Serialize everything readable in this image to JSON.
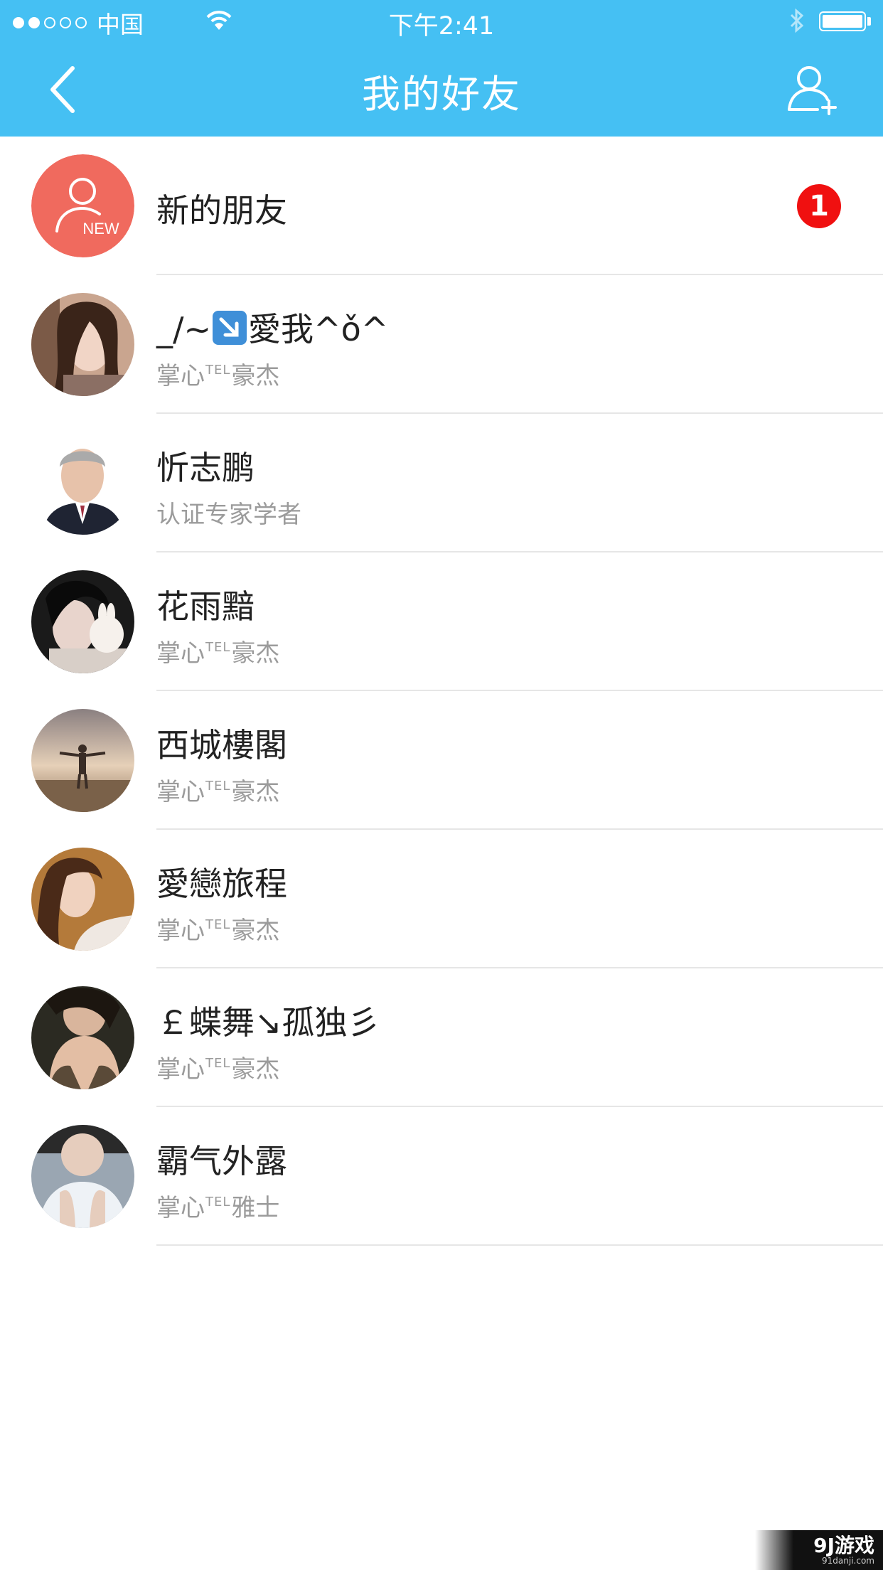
{
  "status_bar": {
    "carrier": "中国",
    "time": "下午2:41"
  },
  "nav": {
    "title": "我的好友",
    "back_icon": "chevron-left-icon",
    "add_icon": "add-user-icon"
  },
  "new_friends": {
    "label": "新的朋友",
    "avatar_text": "NEW",
    "badge_count": "1",
    "avatar_color": "#f06a5e"
  },
  "friends": [
    {
      "name_pre": "_/~",
      "name_post": "愛我^ǒ^",
      "sub_pre": "掌心",
      "sub_tel": "TEL",
      "sub_post": "豪杰"
    },
    {
      "name": "忻志鹏",
      "sub": "认证专家学者"
    },
    {
      "name": "花雨黯",
      "sub_pre": "掌心",
      "sub_tel": "TEL",
      "sub_post": "豪杰"
    },
    {
      "name": "西城樓閣",
      "sub_pre": "掌心",
      "sub_tel": "TEL",
      "sub_post": "豪杰"
    },
    {
      "name": "愛戀旅程",
      "sub_pre": "掌心",
      "sub_tel": "TEL",
      "sub_post": "豪杰"
    },
    {
      "name": "￡蝶舞↘孤独彡",
      "sub_pre": "掌心",
      "sub_tel": "TEL",
      "sub_post": "豪杰"
    },
    {
      "name": "霸气外露",
      "sub_pre": "掌心",
      "sub_tel": "TEL",
      "sub_post": "雅士"
    }
  ],
  "watermark": {
    "brand": "9J游戏",
    "url": "91danji.com"
  },
  "colors": {
    "header": "#45c0f3",
    "badge": "#f01010"
  }
}
